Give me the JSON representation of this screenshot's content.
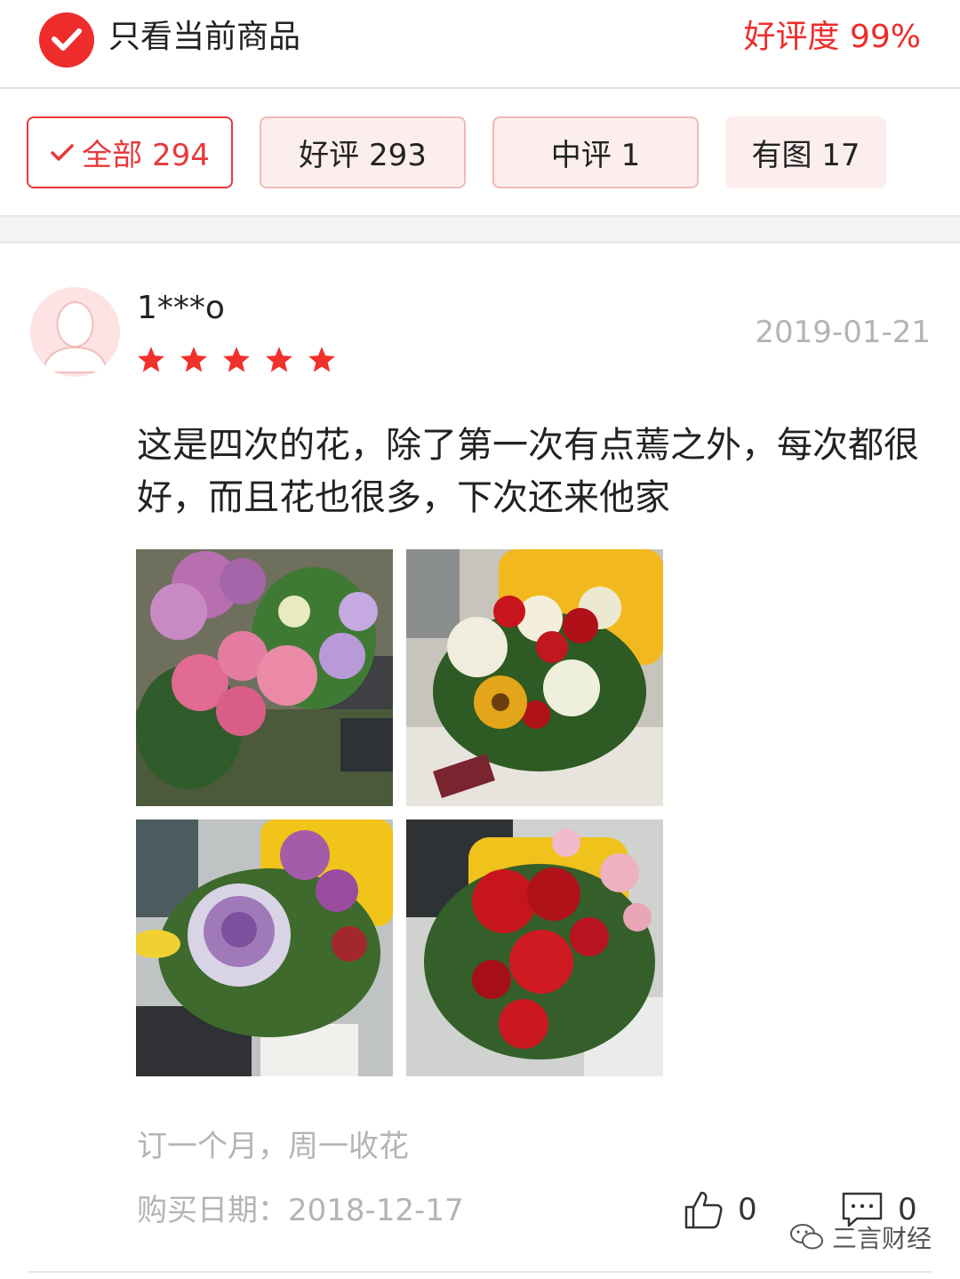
{
  "header": {
    "filter_label": "只看当前商品",
    "rating_summary": "好评度 99%"
  },
  "tabs": [
    {
      "label": "全部 294",
      "active": true
    },
    {
      "label": "好评 293",
      "active": false
    },
    {
      "label": "中评 1",
      "active": false
    },
    {
      "label": "有图 17",
      "active": false
    }
  ],
  "review": {
    "username": "1***o",
    "stars": 5,
    "date": "2019-01-21",
    "text": "这是四次的花，除了第一次有点蔫之外，每次都很好，而且花也很多，下次还来他家",
    "photos": [
      "pink-roses-bouquet",
      "white-roses-red-carnations",
      "purple-kale-bouquet",
      "red-roses-bouquet"
    ],
    "note": "订一个月，周一收花",
    "purchase_date": "购买日期：2018-12-17",
    "likes": "0",
    "comments": "0"
  },
  "watermark": "三言财经",
  "colors": {
    "accent": "#ee2c2c",
    "tab_bg": "#fdeeee",
    "muted_text": "#b4b4b4"
  }
}
